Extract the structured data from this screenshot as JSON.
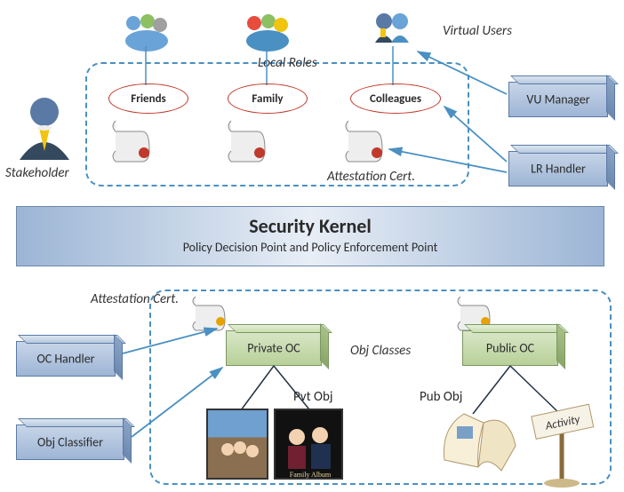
{
  "diagram": {
    "title": "Security Kernel",
    "subtitle": "Policy Decision Point and Policy Enforcement Point",
    "upper": {
      "boundary_label": "Local Roles",
      "virtual_users_label": "Virtual Users",
      "stakeholder_label": "Stakeholder",
      "attestation_label": "Attestation Cert.",
      "roles": [
        "Friends",
        "Family",
        "Colleagues"
      ],
      "managers": {
        "vu_manager": "VU Manager",
        "lr_handler": "LR Handler"
      }
    },
    "lower": {
      "boundary_label": "Obj Classes",
      "attestation_label": "Attestation Cert.",
      "oc_private": "Private OC",
      "oc_public": "Public OC",
      "pvt_obj_label": "Pvt Obj",
      "pub_obj_label": "Pub Obj",
      "activity_sign": "Activity",
      "family_album_caption": "Family Album",
      "handlers": {
        "oc_handler": "OC Handler",
        "obj_classifier": "Obj Classifier"
      }
    }
  },
  "chart_data": {
    "type": "diagram",
    "title": "Security Kernel Architecture",
    "nodes": [
      {
        "id": "stakeholder",
        "label": "Stakeholder",
        "type": "actor"
      },
      {
        "id": "virtual_users",
        "label": "Virtual Users",
        "type": "actor-group"
      },
      {
        "id": "friends",
        "label": "Friends",
        "type": "local-role"
      },
      {
        "id": "family",
        "label": "Family",
        "type": "local-role"
      },
      {
        "id": "colleagues",
        "label": "Colleagues",
        "type": "local-role"
      },
      {
        "id": "vu_manager",
        "label": "VU Manager",
        "type": "component"
      },
      {
        "id": "lr_handler",
        "label": "LR Handler",
        "type": "component"
      },
      {
        "id": "security_kernel",
        "label": "Security Kernel",
        "subtitle": "Policy Decision Point and Policy Enforcement Point",
        "type": "kernel"
      },
      {
        "id": "oc_handler",
        "label": "OC Handler",
        "type": "component"
      },
      {
        "id": "obj_classifier",
        "label": "Obj Classifier",
        "type": "component"
      },
      {
        "id": "private_oc",
        "label": "Private OC",
        "type": "object-class"
      },
      {
        "id": "public_oc",
        "label": "Public OC",
        "type": "object-class"
      },
      {
        "id": "pvt_obj",
        "label": "Pvt Obj",
        "type": "object"
      },
      {
        "id": "pub_obj",
        "label": "Pub Obj",
        "type": "object"
      },
      {
        "id": "attestation_cert_upper",
        "label": "Attestation Cert.",
        "type": "artifact"
      },
      {
        "id": "attestation_cert_lower",
        "label": "Attestation Cert.",
        "type": "artifact"
      }
    ],
    "edges": [
      {
        "from": "virtual_users",
        "to": "friends"
      },
      {
        "from": "virtual_users",
        "to": "family"
      },
      {
        "from": "virtual_users",
        "to": "colleagues"
      },
      {
        "from": "vu_manager",
        "to": "virtual_users"
      },
      {
        "from": "lr_handler",
        "to": "colleagues"
      },
      {
        "from": "lr_handler",
        "to": "attestation_cert_upper"
      },
      {
        "from": "oc_handler",
        "to": "private_oc"
      },
      {
        "from": "obj_classifier",
        "to": "private_oc"
      },
      {
        "from": "private_oc",
        "to": "pvt_obj"
      },
      {
        "from": "public_oc",
        "to": "pub_obj"
      }
    ],
    "groups": [
      {
        "id": "local_roles",
        "label": "Local Roles",
        "contains": [
          "friends",
          "family",
          "colleagues",
          "attestation_cert_upper"
        ]
      },
      {
        "id": "obj_classes",
        "label": "Obj Classes",
        "contains": [
          "private_oc",
          "public_oc",
          "pvt_obj",
          "pub_obj",
          "attestation_cert_lower"
        ]
      }
    ]
  }
}
